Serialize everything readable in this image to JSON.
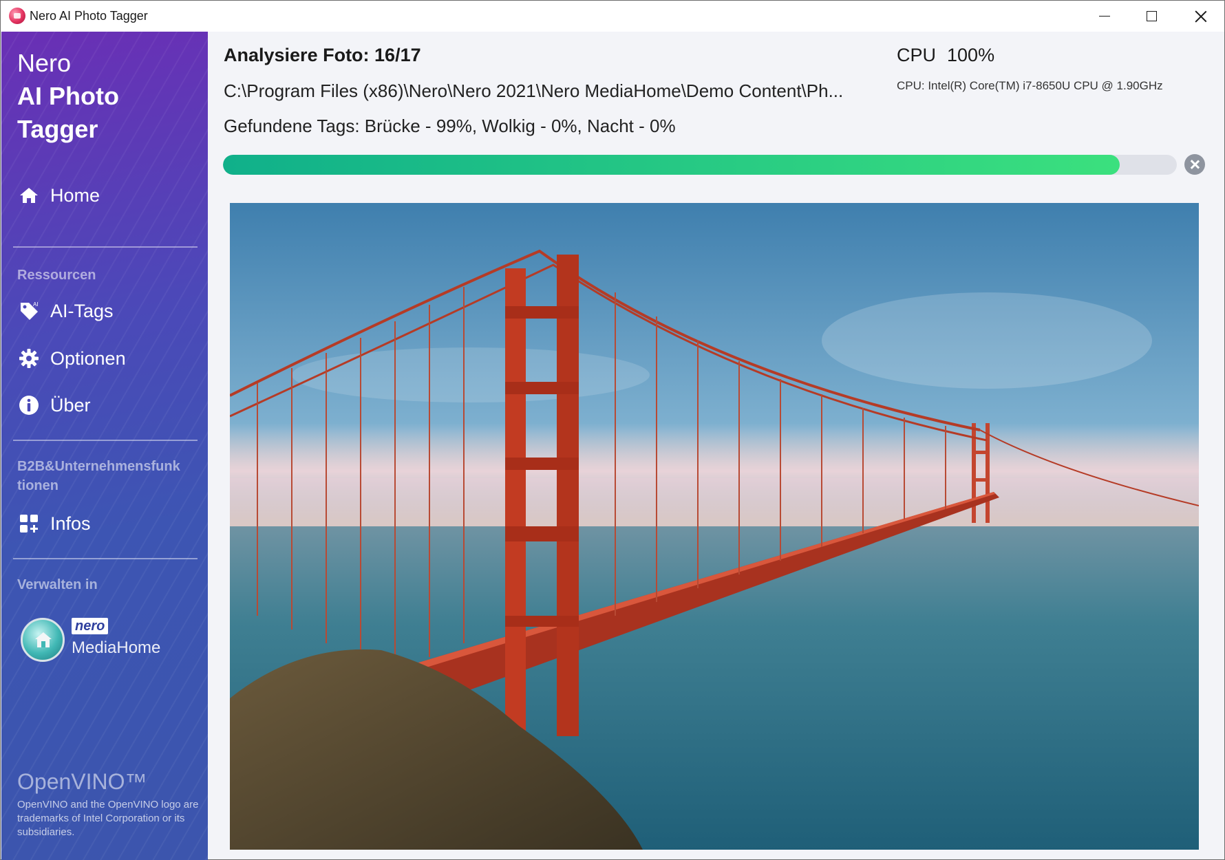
{
  "window": {
    "title": "Nero AI Photo Tagger"
  },
  "sidebar": {
    "brand": {
      "line1": "Nero",
      "line2": "AI Photo",
      "line3": "Tagger"
    },
    "home": {
      "label": "Home",
      "icon": "home-icon"
    },
    "section_resources": "Ressourcen",
    "ai_tags": {
      "label": "AI-Tags",
      "icon": "tag-icon"
    },
    "options": {
      "label": "Optionen",
      "icon": "gear-icon"
    },
    "about": {
      "label": "Über",
      "icon": "info-icon"
    },
    "section_b2b": "B2B&Unternehmensfunk tionen",
    "infos": {
      "label": "Infos",
      "icon": "grid-plus-icon"
    },
    "section_manage": "Verwalten in",
    "mediahome": {
      "brand": "nero",
      "label": "MediaHome"
    },
    "openvino": {
      "logo": "OpenVINO™",
      "note": "OpenVINO and the OpenVINO logo are trademarks of Intel Corporation or its subsidiaries."
    }
  },
  "main": {
    "title": "Analysiere Foto: 16/17",
    "path": "C:\\Program Files (x86)\\Nero\\Nero 2021\\Nero MediaHome\\Demo Content\\Ph...",
    "tags": "Gefundene Tags: Brücke - 99%, Wolkig - 0%, Nacht - 0%",
    "cpu_label": "CPU",
    "cpu_value": "100%",
    "cpu_model": "CPU: Intel(R) Core(TM) i7-8650U CPU @ 1.90GHz",
    "progress_fraction": 0.94,
    "progress_color_start": "#10b08a",
    "progress_color_end": "#3be07e",
    "accent_color": "#4b49b8"
  }
}
